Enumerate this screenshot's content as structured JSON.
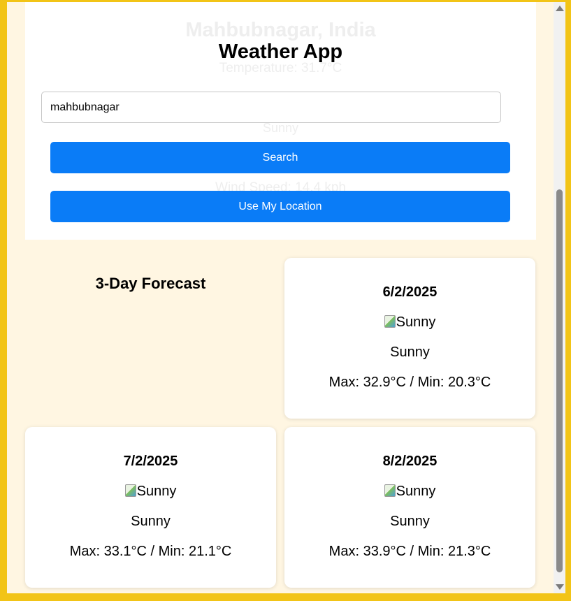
{
  "background_ghost": {
    "city": "Mahbubnagar, India",
    "temperature": "Temperature: 31.7°C",
    "icon_alt": "Sunny",
    "wind": "Wind Speed: 14.4 kph"
  },
  "header": {
    "title": "Weather App"
  },
  "search": {
    "value": "mahbubnagar",
    "search_label": "Search",
    "location_label": "Use My Location"
  },
  "forecast": {
    "title": "3-Day Forecast",
    "days": [
      {
        "date": "6/2/2025",
        "icon_alt": "Sunny",
        "condition": "Sunny",
        "range": "Max: 32.9°C / Min: 20.3°C"
      },
      {
        "date": "7/2/2025",
        "icon_alt": "Sunny",
        "condition": "Sunny",
        "range": "Max: 33.1°C / Min: 21.1°C"
      },
      {
        "date": "8/2/2025",
        "icon_alt": "Sunny",
        "condition": "Sunny",
        "range": "Max: 33.9°C / Min: 21.3°C"
      }
    ]
  },
  "colors": {
    "page_border": "#f2c417",
    "page_bg": "#fff6e2",
    "accent": "#0a7cf7"
  }
}
